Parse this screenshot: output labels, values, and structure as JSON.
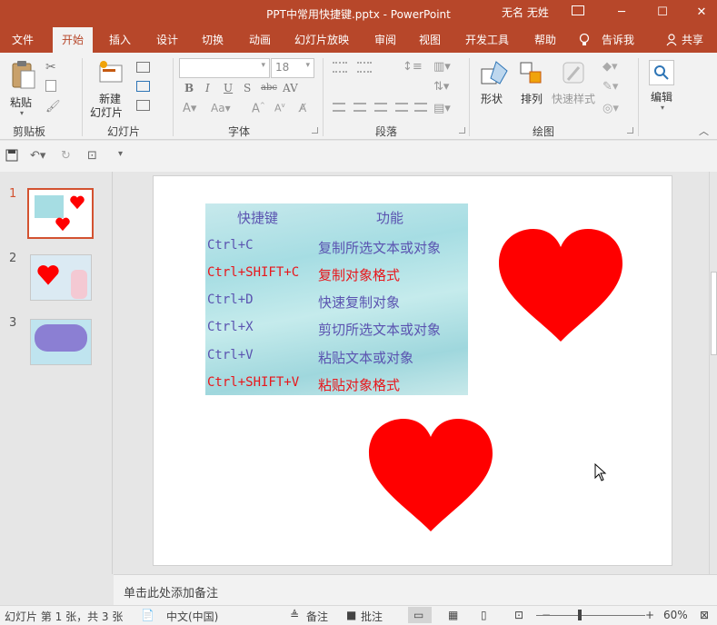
{
  "window": {
    "title": "PPT中常用快捷键.pptx  -  PowerPoint",
    "user": "无名 无姓",
    "controls": [
      "restore-ribbon",
      "minimize",
      "maximize",
      "close"
    ]
  },
  "tabs": [
    {
      "label": "文件"
    },
    {
      "label": "开始"
    },
    {
      "label": "插入"
    },
    {
      "label": "设计"
    },
    {
      "label": "切换"
    },
    {
      "label": "动画"
    },
    {
      "label": "幻灯片放映"
    },
    {
      "label": "审阅"
    },
    {
      "label": "视图"
    },
    {
      "label": "开发工具"
    },
    {
      "label": "帮助"
    }
  ],
  "tell_me": "告诉我",
  "share": "共享",
  "ribbon": {
    "paste": "粘贴",
    "new_slide_line1": "新建",
    "new_slide_line2": "幻灯片",
    "font_size": "18",
    "shape": "形状",
    "arrange": "排列",
    "quick_style": "快速样式",
    "edit": "编辑",
    "groups": {
      "clipboard": "剪贴板",
      "slides": "幻灯片",
      "font": "字体",
      "paragraph": "段落",
      "drawing": "绘图"
    },
    "font_format": [
      "B",
      "I",
      "U",
      "S",
      "abc",
      "AV"
    ]
  },
  "thumbnails": [
    {
      "num": "1",
      "selected": true
    },
    {
      "num": "2",
      "selected": false
    },
    {
      "num": "3",
      "selected": false
    }
  ],
  "slide": {
    "table": {
      "header_key": "快捷键",
      "header_func": "功能",
      "rows": [
        {
          "key": "Ctrl+C",
          "func": "复制所选文本或对象",
          "color": "#5a53b0"
        },
        {
          "key": "Ctrl+SHIFT+C",
          "func": "复制对象格式",
          "color": "#e8161b"
        },
        {
          "key": "Ctrl+D",
          "func": "快速复制对象",
          "color": "#5a53b0"
        },
        {
          "key": "Ctrl+X",
          "func": "剪切所选文本或对象",
          "color": "#5a53b0"
        },
        {
          "key": "Ctrl+V",
          "func": "粘贴文本或对象",
          "color": "#5a53b0"
        },
        {
          "key": "Ctrl+SHIFT+V",
          "func": "粘贴对象格式",
          "color": "#e8161b"
        }
      ]
    },
    "heart_color": "#ff0000"
  },
  "notes_placeholder": "单击此处添加备注",
  "status": {
    "slide_info": "幻灯片 第 1 张，共 3 张",
    "language": "中文(中国)",
    "notes": "备注",
    "comments": "批注",
    "zoom": "60%"
  },
  "colors": {
    "accent": "#b7472a",
    "thumb_selected": "#d35230"
  }
}
